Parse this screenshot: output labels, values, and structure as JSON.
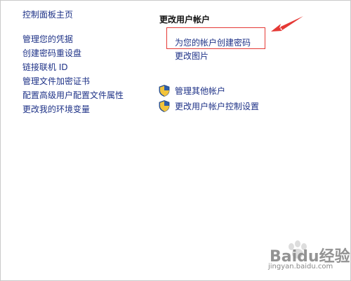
{
  "left_nav": {
    "home": "控制面板主页",
    "items": [
      "管理您的凭据",
      "创建密码重设盘",
      "链接联机 ID",
      "管理文件加密证书",
      "配置高级用户配置文件属性",
      "更改我的环境变量"
    ]
  },
  "main": {
    "heading": "更改用户帐户",
    "links": [
      "为您的帐户创建密码",
      "更改图片"
    ],
    "uac_links": [
      {
        "label": "管理其他帐户",
        "icon": "uac-shield-icon"
      },
      {
        "label": "更改用户帐户控制设置",
        "icon": "uac-shield-icon"
      }
    ]
  },
  "watermark": {
    "text": "Baidu经验",
    "url": "jingyan.baidu.com"
  },
  "colors": {
    "link": "#1e3287",
    "highlight": "#e53935"
  }
}
